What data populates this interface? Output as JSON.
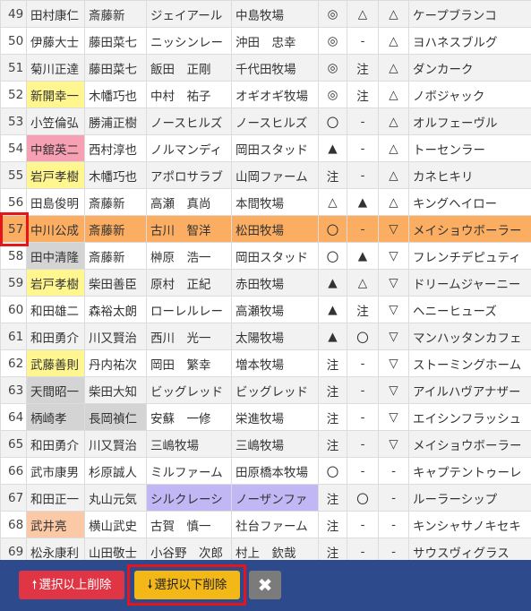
{
  "rows": [
    {
      "num": "49",
      "jockey": "田村康仁",
      "trainer": "斎藤新",
      "owner": "ジェイアール",
      "breeder": "中島牧場",
      "m1": "◎",
      "m2": "△",
      "m3": "△",
      "sire": "ケープブランコ"
    },
    {
      "num": "50",
      "jockey": "伊藤大士",
      "trainer": "藤田菜七",
      "owner": "ニッシンレー",
      "breeder": "沖田　忠幸",
      "m1": "◎",
      "m2": "-",
      "m3": "△",
      "sire": "ヨハネスブルグ"
    },
    {
      "num": "51",
      "jockey": "菊川正達",
      "trainer": "藤田菜七",
      "owner": "飯田　正剛",
      "breeder": "千代田牧場",
      "m1": "◎",
      "m2": "注",
      "m3": "△",
      "sire": "ダンカーク"
    },
    {
      "num": "52",
      "jockey": "新開幸一",
      "trainer": "木幡巧也",
      "owner": "中村　祐子",
      "breeder": "オギオギ牧場",
      "m1": "◎",
      "m2": "注",
      "m3": "△",
      "sire": "ノボジャック"
    },
    {
      "num": "53",
      "jockey": "小笠倫弘",
      "trainer": "勝浦正樹",
      "owner": "ノースヒルズ",
      "breeder": "ノースヒルズ",
      "m1": "〇",
      "m2": "-",
      "m3": "△",
      "sire": "オルフェーヴル"
    },
    {
      "num": "54",
      "jockey": "中舘英二",
      "trainer": "西村淳也",
      "owner": "ノルマンディ",
      "breeder": "岡田スタッド",
      "m1": "▲",
      "m2": "-",
      "m3": "△",
      "sire": "トーセンラー"
    },
    {
      "num": "55",
      "jockey": "岩戸孝樹",
      "trainer": "木幡巧也",
      "owner": "アポロサラブ",
      "breeder": "山岡ファーム",
      "m1": "注",
      "m2": "-",
      "m3": "△",
      "sire": "カネヒキリ"
    },
    {
      "num": "56",
      "jockey": "田島俊明",
      "trainer": "斎藤新",
      "owner": "高瀬　真尚",
      "breeder": "本間牧場",
      "m1": "△",
      "m2": "▲",
      "m3": "△",
      "sire": "キングヘイロー"
    },
    {
      "num": "57",
      "jockey": "中川公成",
      "trainer": "斎藤新",
      "owner": "古川　智洋",
      "breeder": "松田牧場",
      "m1": "〇",
      "m2": "-",
      "m3": "▽",
      "sire": "メイショウボーラー"
    },
    {
      "num": "58",
      "jockey": "田中清隆",
      "trainer": "斎藤新",
      "owner": "榊原　浩一",
      "breeder": "岡田スタッド",
      "m1": "〇",
      "m2": "▲",
      "m3": "▽",
      "sire": "フレンチデピュティ"
    },
    {
      "num": "59",
      "jockey": "岩戸孝樹",
      "trainer": "柴田善臣",
      "owner": "原村　正紀",
      "breeder": "赤田牧場",
      "m1": "▲",
      "m2": "△",
      "m3": "▽",
      "sire": "ドリームジャーニー"
    },
    {
      "num": "60",
      "jockey": "和田雄二",
      "trainer": "森裕太朗",
      "owner": "ローレルレー",
      "breeder": "高瀬牧場",
      "m1": "▲",
      "m2": "注",
      "m3": "▽",
      "sire": "ヘニーヒューズ"
    },
    {
      "num": "61",
      "jockey": "和田勇介",
      "trainer": "川又賢治",
      "owner": "西川　光一",
      "breeder": "太陽牧場",
      "m1": "▲",
      "m2": "〇",
      "m3": "▽",
      "sire": "マンハッタンカフェ"
    },
    {
      "num": "62",
      "jockey": "武藤善則",
      "trainer": "丹内祐次",
      "owner": "岡田　繁幸",
      "breeder": "増本牧場",
      "m1": "注",
      "m2": "-",
      "m3": "▽",
      "sire": "ストーミングホーム"
    },
    {
      "num": "63",
      "jockey": "天間昭一",
      "trainer": "柴田大知",
      "owner": "ビッグレッド",
      "breeder": "ビッグレッド",
      "m1": "注",
      "m2": "-",
      "m3": "▽",
      "sire": "アイルハヴアナザー"
    },
    {
      "num": "64",
      "jockey": "柄崎孝",
      "trainer": "長岡禎仁",
      "owner": "安蘇　一修",
      "breeder": "栄進牧場",
      "m1": "注",
      "m2": "-",
      "m3": "▽",
      "sire": "エイシンフラッシュ"
    },
    {
      "num": "65",
      "jockey": "和田勇介",
      "trainer": "川又賢治",
      "owner": "三嶋牧場",
      "breeder": "三嶋牧場",
      "m1": "注",
      "m2": "-",
      "m3": "▽",
      "sire": "メイショウボーラー"
    },
    {
      "num": "66",
      "jockey": "武市康男",
      "trainer": "杉原誠人",
      "owner": "ミルファーム",
      "breeder": "田原橋本牧場",
      "m1": "〇",
      "m2": "-",
      "m3": "-",
      "sire": "キャプテントゥーレ"
    },
    {
      "num": "67",
      "jockey": "和田正一",
      "trainer": "丸山元気",
      "owner": "シルクレーシ",
      "breeder": "ノーザンファ",
      "m1": "注",
      "m2": "〇",
      "m3": "-",
      "sire": "ルーラーシップ"
    },
    {
      "num": "68",
      "jockey": "武井亮",
      "trainer": "横山武史",
      "owner": "古賀　慎一",
      "breeder": "社台ファーム",
      "m1": "注",
      "m2": "-",
      "m3": "-",
      "sire": "キンシャサノキセキ"
    },
    {
      "num": "69",
      "jockey": "松永康利",
      "trainer": "山田敬士",
      "owner": "小谷野　次郎",
      "breeder": "村上　欽哉",
      "m1": "注",
      "m2": "-",
      "m3": "-",
      "sire": "サウスヴィグラス"
    }
  ],
  "toolbar": {
    "delete_above_label": "選択以上削除",
    "delete_above_icon": "arrow-up-icon",
    "delete_below_label": "選択以下削除",
    "delete_below_icon": "arrow-down-icon",
    "close_icon": "close-icon",
    "close_glyph": "✖"
  },
  "colors": {
    "selected_row": "#fbae62",
    "highlight_yellow": "#fff68f",
    "highlight_pink": "#f7a0b4",
    "highlight_peach": "#fbc9a5",
    "highlight_purple": "#c2b7f5",
    "toolbar_bg": "#2c4a8c",
    "danger": "#e03545",
    "warning": "#f3b818",
    "marker_red": "#e6141b"
  }
}
